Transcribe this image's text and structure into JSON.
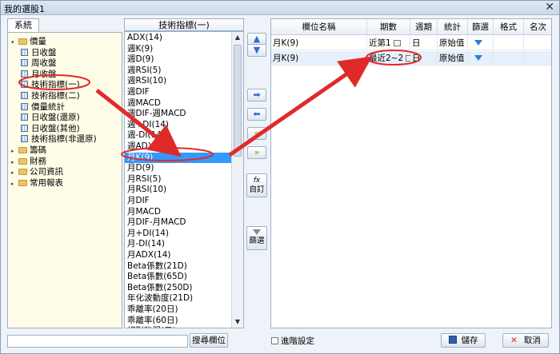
{
  "window": {
    "title": "我的選股1",
    "close_glyph": "✕"
  },
  "left_tab": {
    "label": "系統"
  },
  "tree": [
    {
      "label": "價量",
      "kind": "folder",
      "expanded": true,
      "level": 0
    },
    {
      "label": "日收盤",
      "kind": "item",
      "level": 1
    },
    {
      "label": "周收盤",
      "kind": "item",
      "level": 1
    },
    {
      "label": "月收盤",
      "kind": "item",
      "level": 1
    },
    {
      "label": "技術指標(一)",
      "kind": "item",
      "level": 1
    },
    {
      "label": "技術指標(二)",
      "kind": "item",
      "level": 1
    },
    {
      "label": "價量統計",
      "kind": "item",
      "level": 1
    },
    {
      "label": "日收盤(還原)",
      "kind": "item",
      "level": 1
    },
    {
      "label": "日收盤(其他)",
      "kind": "item",
      "level": 1
    },
    {
      "label": "技術指標(非還原)",
      "kind": "item",
      "level": 1
    },
    {
      "label": "籌碼",
      "kind": "folder",
      "expanded": false,
      "level": 0
    },
    {
      "label": "財務",
      "kind": "folder",
      "expanded": false,
      "level": 0
    },
    {
      "label": "公司資訊",
      "kind": "folder",
      "expanded": false,
      "level": 0
    },
    {
      "label": "常用報表",
      "kind": "folder",
      "expanded": false,
      "level": 0
    }
  ],
  "list": {
    "header": "技術指標(一)",
    "selected": "月K(9)",
    "items": [
      "ADX(14)",
      "週K(9)",
      "週D(9)",
      "週RSI(5)",
      "週RSI(10)",
      "週DIF",
      "週MACD",
      "週DIF-週MACD",
      "週+DI(14)",
      "週-DI(14)",
      "週ADX(14)",
      "月K(9)",
      "月D(9)",
      "月RSI(5)",
      "月RSI(10)",
      "月DIF",
      "月MACD",
      "月DIF-月MACD",
      "月+DI(14)",
      "月-DI(14)",
      "月ADX(14)",
      "Beta係數(21D)",
      "Beta係數(65D)",
      "Beta係數(250D)",
      "年化波動度(21D)",
      "乖離率(20日)",
      "乖離率(60日)",
      "相對強弱(日)"
    ]
  },
  "side_buttons": {
    "move_up": "▲",
    "move_down": "▼",
    "add": "➡",
    "remove": "⬅",
    "remove_all": "«",
    "add_all": "»",
    "custom_icon": "fx",
    "custom_label": "自訂",
    "filter_label": "篩選"
  },
  "grid": {
    "columns": [
      "欄位名稱",
      "期數",
      "週期",
      "統計",
      "篩選",
      "格式",
      "名次"
    ],
    "rows": [
      {
        "name": "月K(9)",
        "period": "近第1",
        "cycle": "日",
        "stat": "原始值"
      },
      {
        "name": "月K(9)",
        "period": "最近2~2",
        "cycle": "日",
        "stat": "原始值"
      }
    ]
  },
  "bottom": {
    "search_value": "",
    "search_button": "搜尋欄位",
    "advanced_label": "進階設定",
    "save_label": "儲存",
    "cancel_label": "取消"
  },
  "colors": {
    "selection": "#3399ff",
    "annotation": "#e02a2a",
    "tree_bg": "#fffde8"
  }
}
